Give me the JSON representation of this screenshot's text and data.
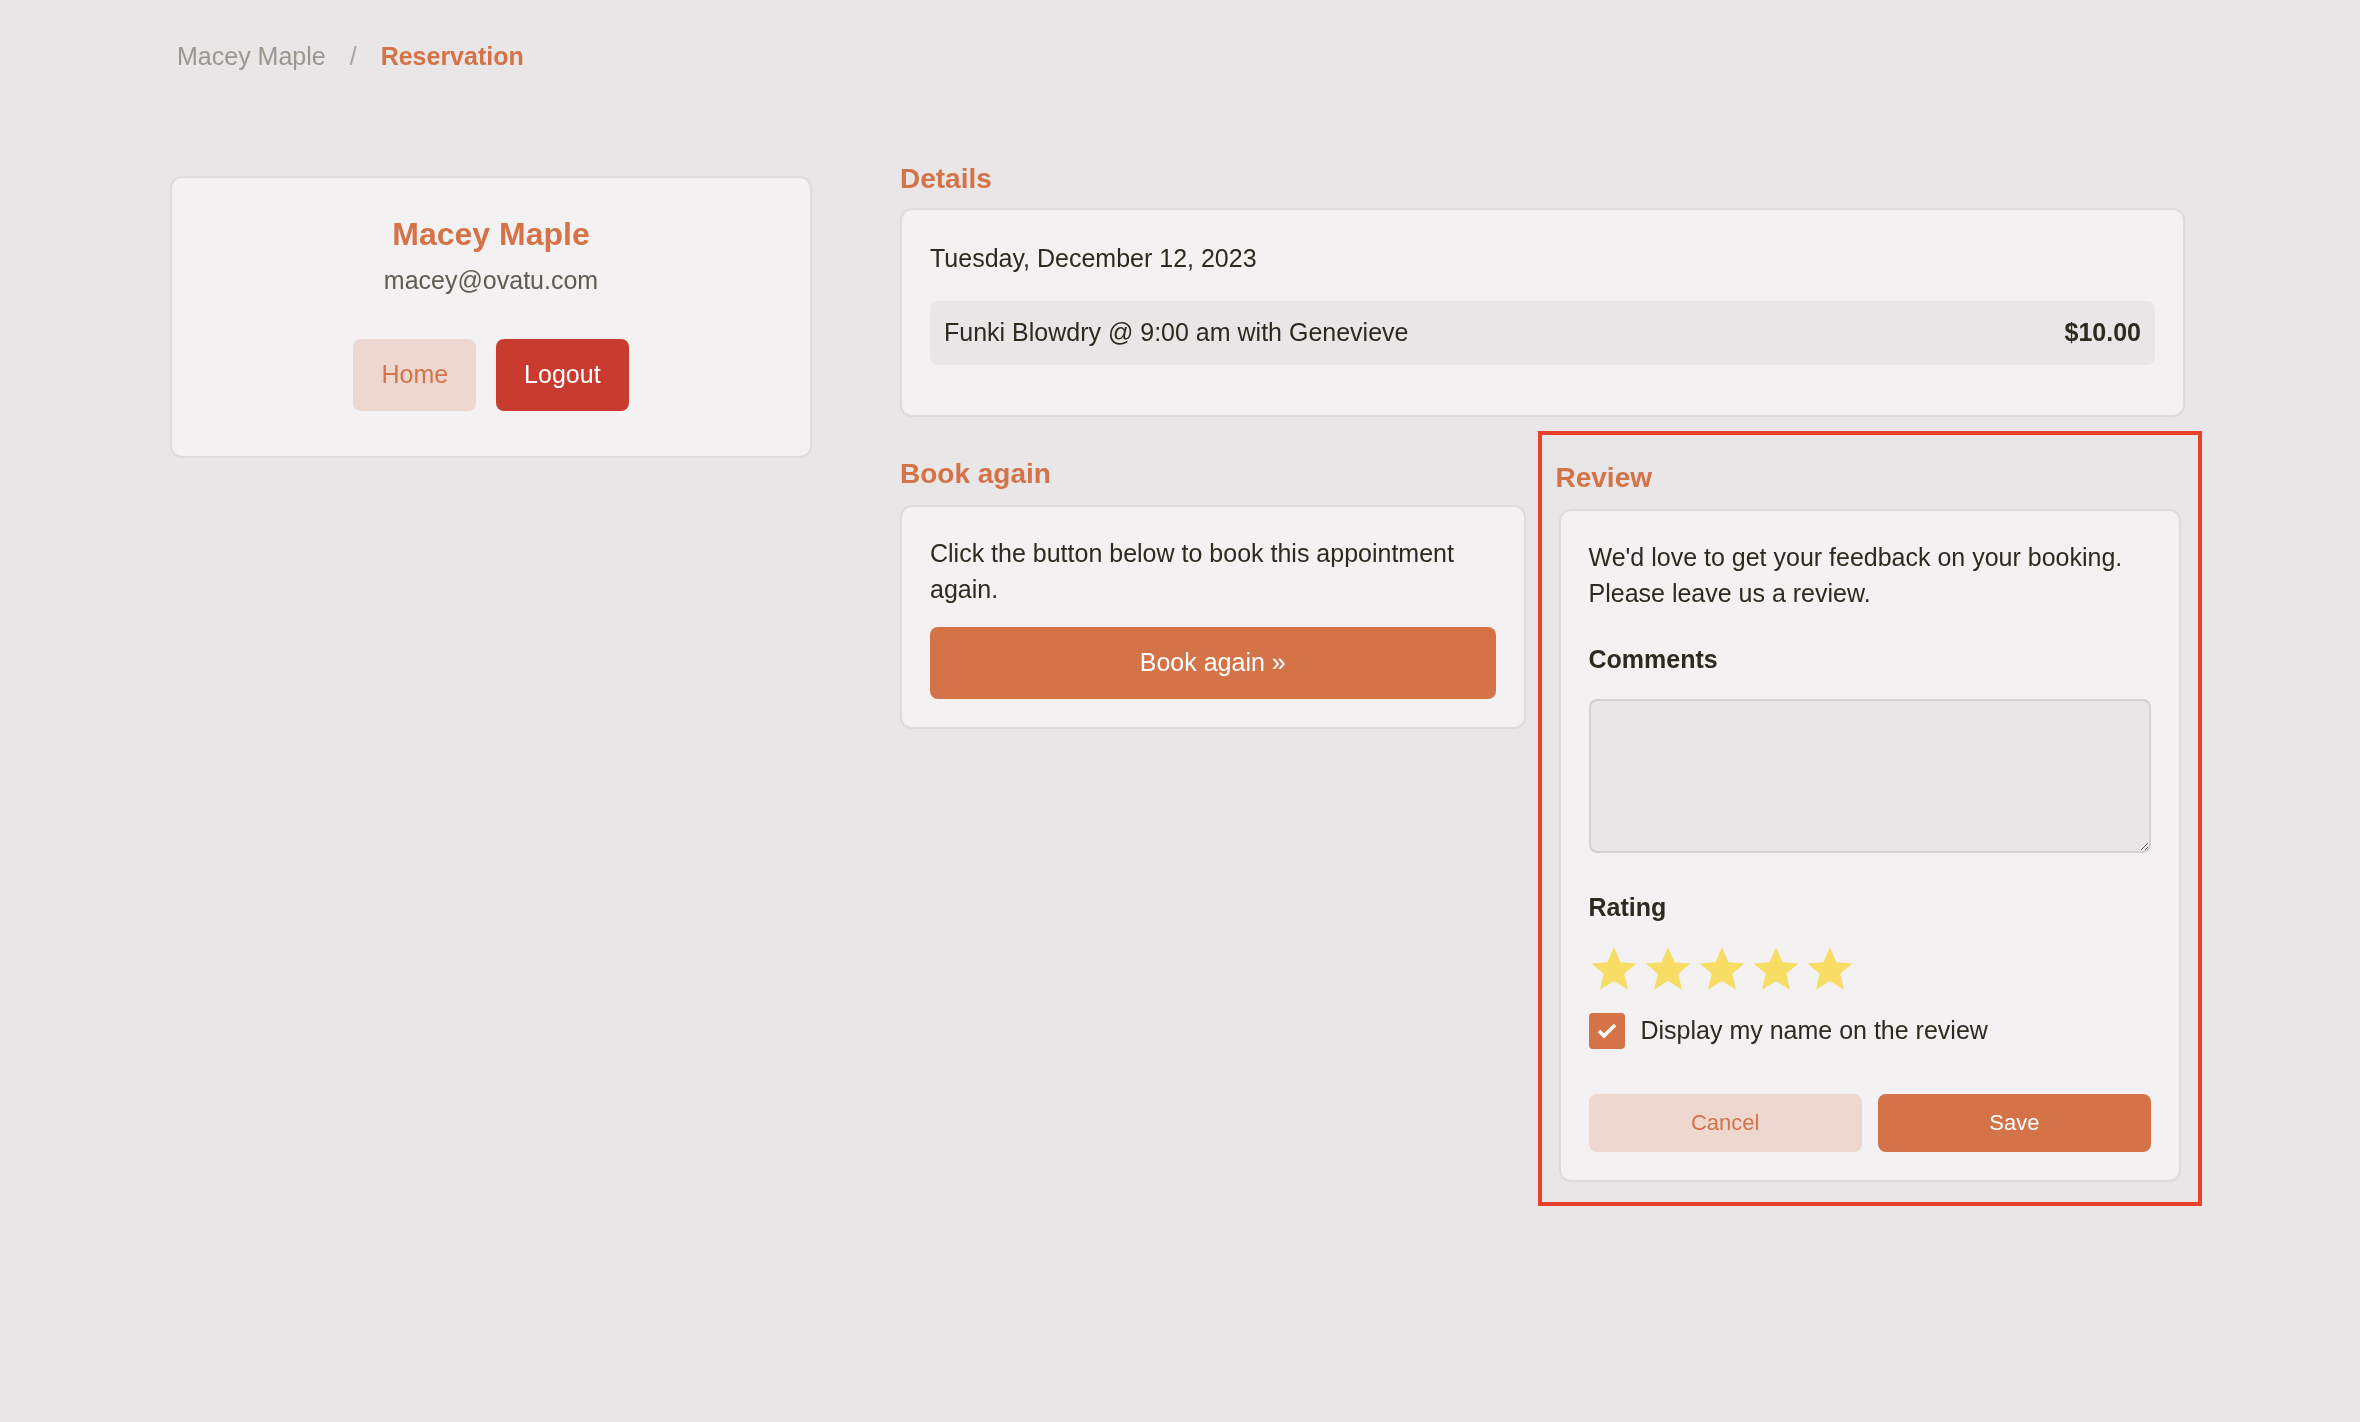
{
  "breadcrumb": [
    {
      "label": "Macey Maple",
      "selected": false
    },
    {
      "label": "Reservation",
      "selected": true
    }
  ],
  "breadcrumb_separator": "/",
  "profile": {
    "name": "Macey Maple",
    "email": "macey@ovatu.com",
    "buttons": [
      {
        "label": "Home",
        "kind": "secondary"
      },
      {
        "label": "Logout",
        "kind": "danger"
      }
    ]
  },
  "details": {
    "heading": "Details",
    "date": "Tuesday, December 12, 2023",
    "service": "Funki Blowdry @ 9:00 am with Genevieve",
    "price": "$10.00"
  },
  "book_again": {
    "heading": "Book again",
    "text": "Click the button below to book this appointment again.",
    "button": "Book again »"
  },
  "review": {
    "heading": "Review",
    "highlighted": true,
    "intro": "We'd love to get your feedback on your booking. Please leave us a review.",
    "comments_label": "Comments",
    "rating_label": "Rating",
    "stars": 5,
    "display_name": {
      "label": "Display my name on the review",
      "checked": true
    },
    "buttons": [
      {
        "label": "Cancel",
        "kind": "secondary"
      },
      {
        "label": "Save",
        "kind": "primary"
      }
    ]
  }
}
